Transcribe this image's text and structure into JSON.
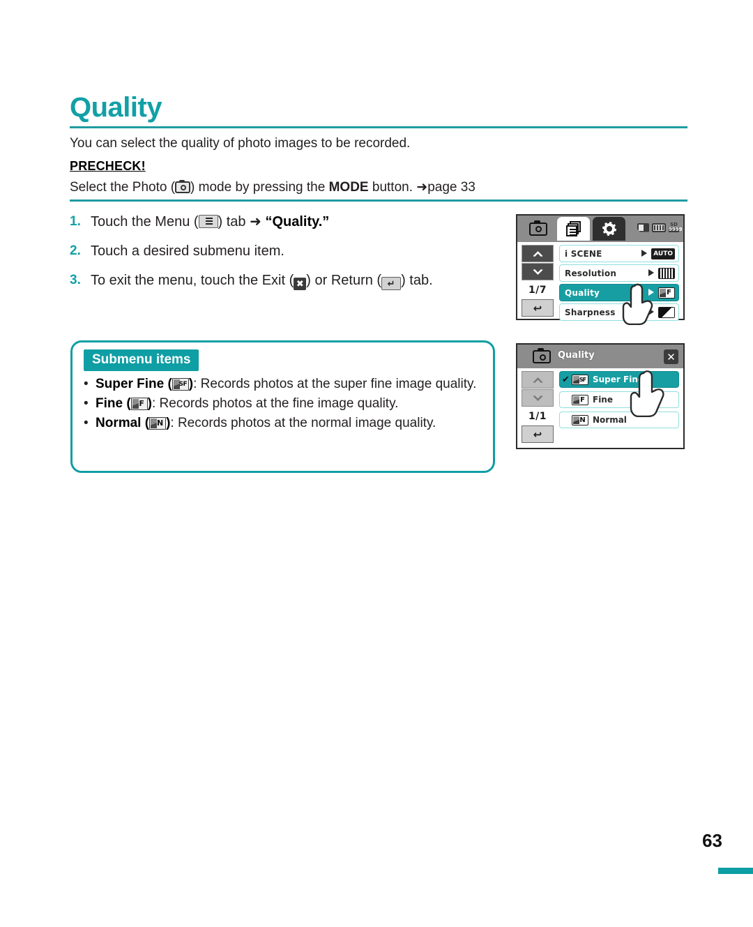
{
  "document": {
    "title": "Quality",
    "intro": "You can select the quality of photo images to be recorded.",
    "precheck_label": "PRECHECK!",
    "precheck_prefix": "Select the Photo (",
    "precheck_suffix": ") mode by pressing the ",
    "precheck_mode_word": "MODE",
    "precheck_tail": " button. ",
    "precheck_arrow": "➜",
    "precheck_page_ref": "page 33",
    "page_number": "63"
  },
  "steps": [
    {
      "num": "1.",
      "pre": "Touch the Menu (",
      "icon": "menu-tab-icon",
      "mid": ") tab ",
      "arrow": "➜",
      "quoted": "“Quality.”"
    },
    {
      "num": "2.",
      "pre": "Touch a desired submenu item.",
      "icon": "",
      "mid": "",
      "arrow": "",
      "quoted": ""
    },
    {
      "num": "3.",
      "pre": "To exit the menu, touch the Exit (",
      "icon": "exit-icon",
      "mid": ") or Return (",
      "icon2": "return-icon",
      "tail": ") tab."
    }
  ],
  "submenu": {
    "tag": "Submenu items",
    "items": [
      {
        "label": "Super Fine",
        "icon_letters": "SF",
        "description": ": Records photos at the super fine image quality."
      },
      {
        "label": "Fine",
        "icon_letters": "F",
        "description": ": Records photos at the fine image quality."
      },
      {
        "label": "Normal",
        "icon_letters": "N",
        "description": ": Records photos at the normal image quality."
      }
    ]
  },
  "lcd_menu_screen": {
    "tabs": [
      {
        "name": "photo-mode-tab",
        "icon": "camera-icon",
        "active": false
      },
      {
        "name": "menu-tab",
        "icon": "menu-list-icon",
        "active": true
      },
      {
        "name": "settings-tab",
        "icon": "gear-icon",
        "active": false
      }
    ],
    "status_icons": [
      "memory-card-icon",
      "battery-icon",
      "sd-counter-icon"
    ],
    "page_indicator": "1/7",
    "back_label": "↩",
    "rows": [
      {
        "label": "i SCENE",
        "value_badge": "AUTO",
        "badge_type": "text",
        "selected": false
      },
      {
        "label": "Resolution",
        "value_badge": "",
        "badge_type": "resolution",
        "selected": false
      },
      {
        "label": "Quality",
        "value_badge": "F",
        "badge_type": "quality",
        "selected": true
      },
      {
        "label": "Sharpness",
        "value_badge": "",
        "badge_type": "sharpness",
        "selected": false
      }
    ]
  },
  "lcd_submenu_screen": {
    "header_icon": "camera-icon",
    "header_title": "Quality",
    "close_label": "✕",
    "page_indicator": "1/1",
    "back_label": "↩",
    "rows": [
      {
        "check": "✔",
        "icon_letters": "SF",
        "label": "Super Fine",
        "selected": true
      },
      {
        "check": "",
        "icon_letters": "F",
        "label": "Fine",
        "selected": false
      },
      {
        "check": "",
        "icon_letters": "N",
        "label": "Normal",
        "selected": false
      }
    ]
  },
  "colors": {
    "accent": "#0e9ea4",
    "heading": "#11a0a6",
    "selected_row": "#179ea2",
    "row_border": "#8fdede"
  }
}
